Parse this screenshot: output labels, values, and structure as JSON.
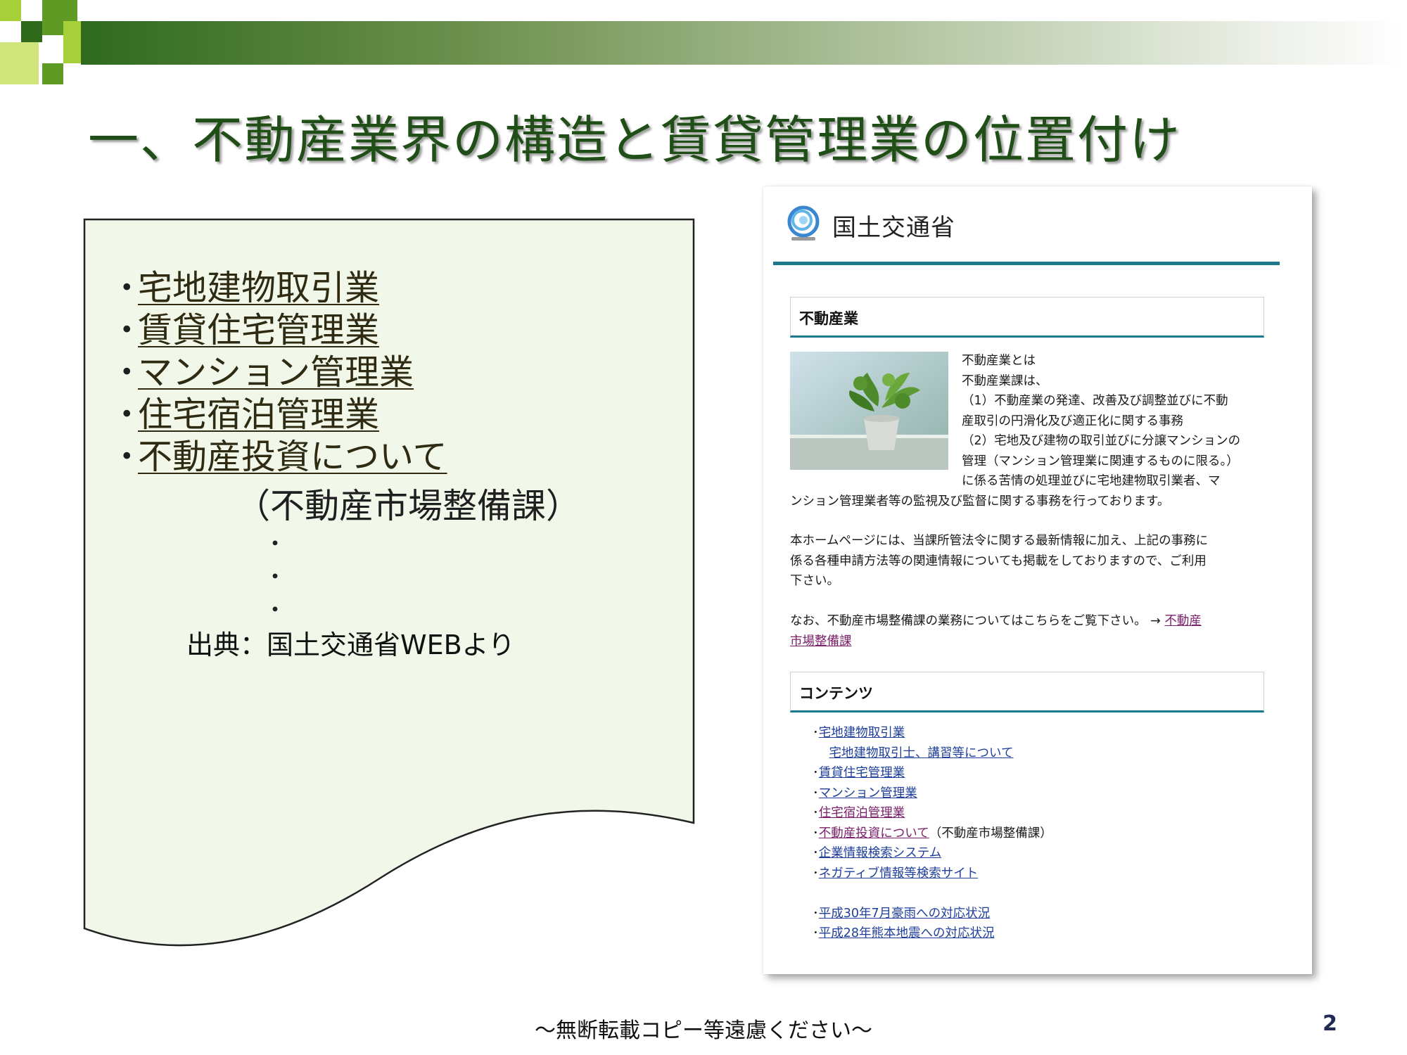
{
  "slide": {
    "title": "一、不動産業界の構造と賃貸管理業の位置付け",
    "topics": [
      {
        "bullet": "･",
        "label": "宅地建物取引業"
      },
      {
        "bullet": "･",
        "label": "賃貸住宅管理業"
      },
      {
        "bullet": "･",
        "label": "マンション管理業"
      },
      {
        "bullet": "･",
        "label": "住宅宿泊管理業"
      },
      {
        "bullet": "･",
        "label": "不動産投資について"
      }
    ],
    "subnote": "（不動産市場整備課）",
    "ellipsis": [
      "・",
      "・",
      "・"
    ],
    "source": "出典：国土交通省WEBより",
    "footer": "～無断転載コピー等遠慮ください～",
    "page_number": "2"
  },
  "web": {
    "ministry_name": "国土交通省",
    "section1_title": "不動産業",
    "intro_lines": [
      "不動産業とは",
      "不動産業課は、",
      "（1）不動産業の発達、改善及び調整並びに不動",
      "産取引の円滑化及び適正化に関する事務",
      "（2）宅地及び建物の取引並びに分譲マンションの",
      "管理（マンション管理業に関連するものに限る。）",
      "に係る苦情の処理並びに宅地建物取引業者、マ"
    ],
    "intro_tail": "ンション管理業者等の監視及び監督に関する事務を行っております。",
    "homepage_lines": [
      "本ホームページには、当課所管法令に関する最新情報に加え、上記の事務に",
      "係る各種申請方法等の関連情報についても掲載をしておりますので、ご利用",
      "下さい。"
    ],
    "market_text": "なお、不動産市場整備課の業務についてはこちらをご覧下さい。 → ",
    "market_link_1": "不動産",
    "market_link_2": "市場整備課",
    "section2_title": "コンテンツ",
    "contents": [
      {
        "prefix": "･",
        "link": "宅地建物取引業",
        "suffix": ""
      },
      {
        "prefix": "　",
        "link": "宅地建物取引士、講習等について",
        "suffix": ""
      },
      {
        "prefix": "･",
        "link": "賃貸住宅管理業",
        "suffix": ""
      },
      {
        "prefix": "･",
        "link": "マンション管理業",
        "suffix": ""
      },
      {
        "prefix": "･",
        "link": "住宅宿泊管理業",
        "suffix": ""
      },
      {
        "prefix": "･",
        "link": "不動産投資について",
        "suffix": "（不動産市場整備課）"
      },
      {
        "prefix": "･",
        "link": "企業情報検索システム",
        "suffix": ""
      },
      {
        "prefix": "･",
        "link": "ネガティブ情報等検索サイト",
        "suffix": ""
      },
      {
        "prefix": "",
        "link": "",
        "suffix": ""
      },
      {
        "prefix": "･",
        "link": "平成30年7月豪雨への対応状況",
        "suffix": ""
      },
      {
        "prefix": "･",
        "link": "平成28年熊本地震への対応状況",
        "suffix": ""
      }
    ]
  }
}
